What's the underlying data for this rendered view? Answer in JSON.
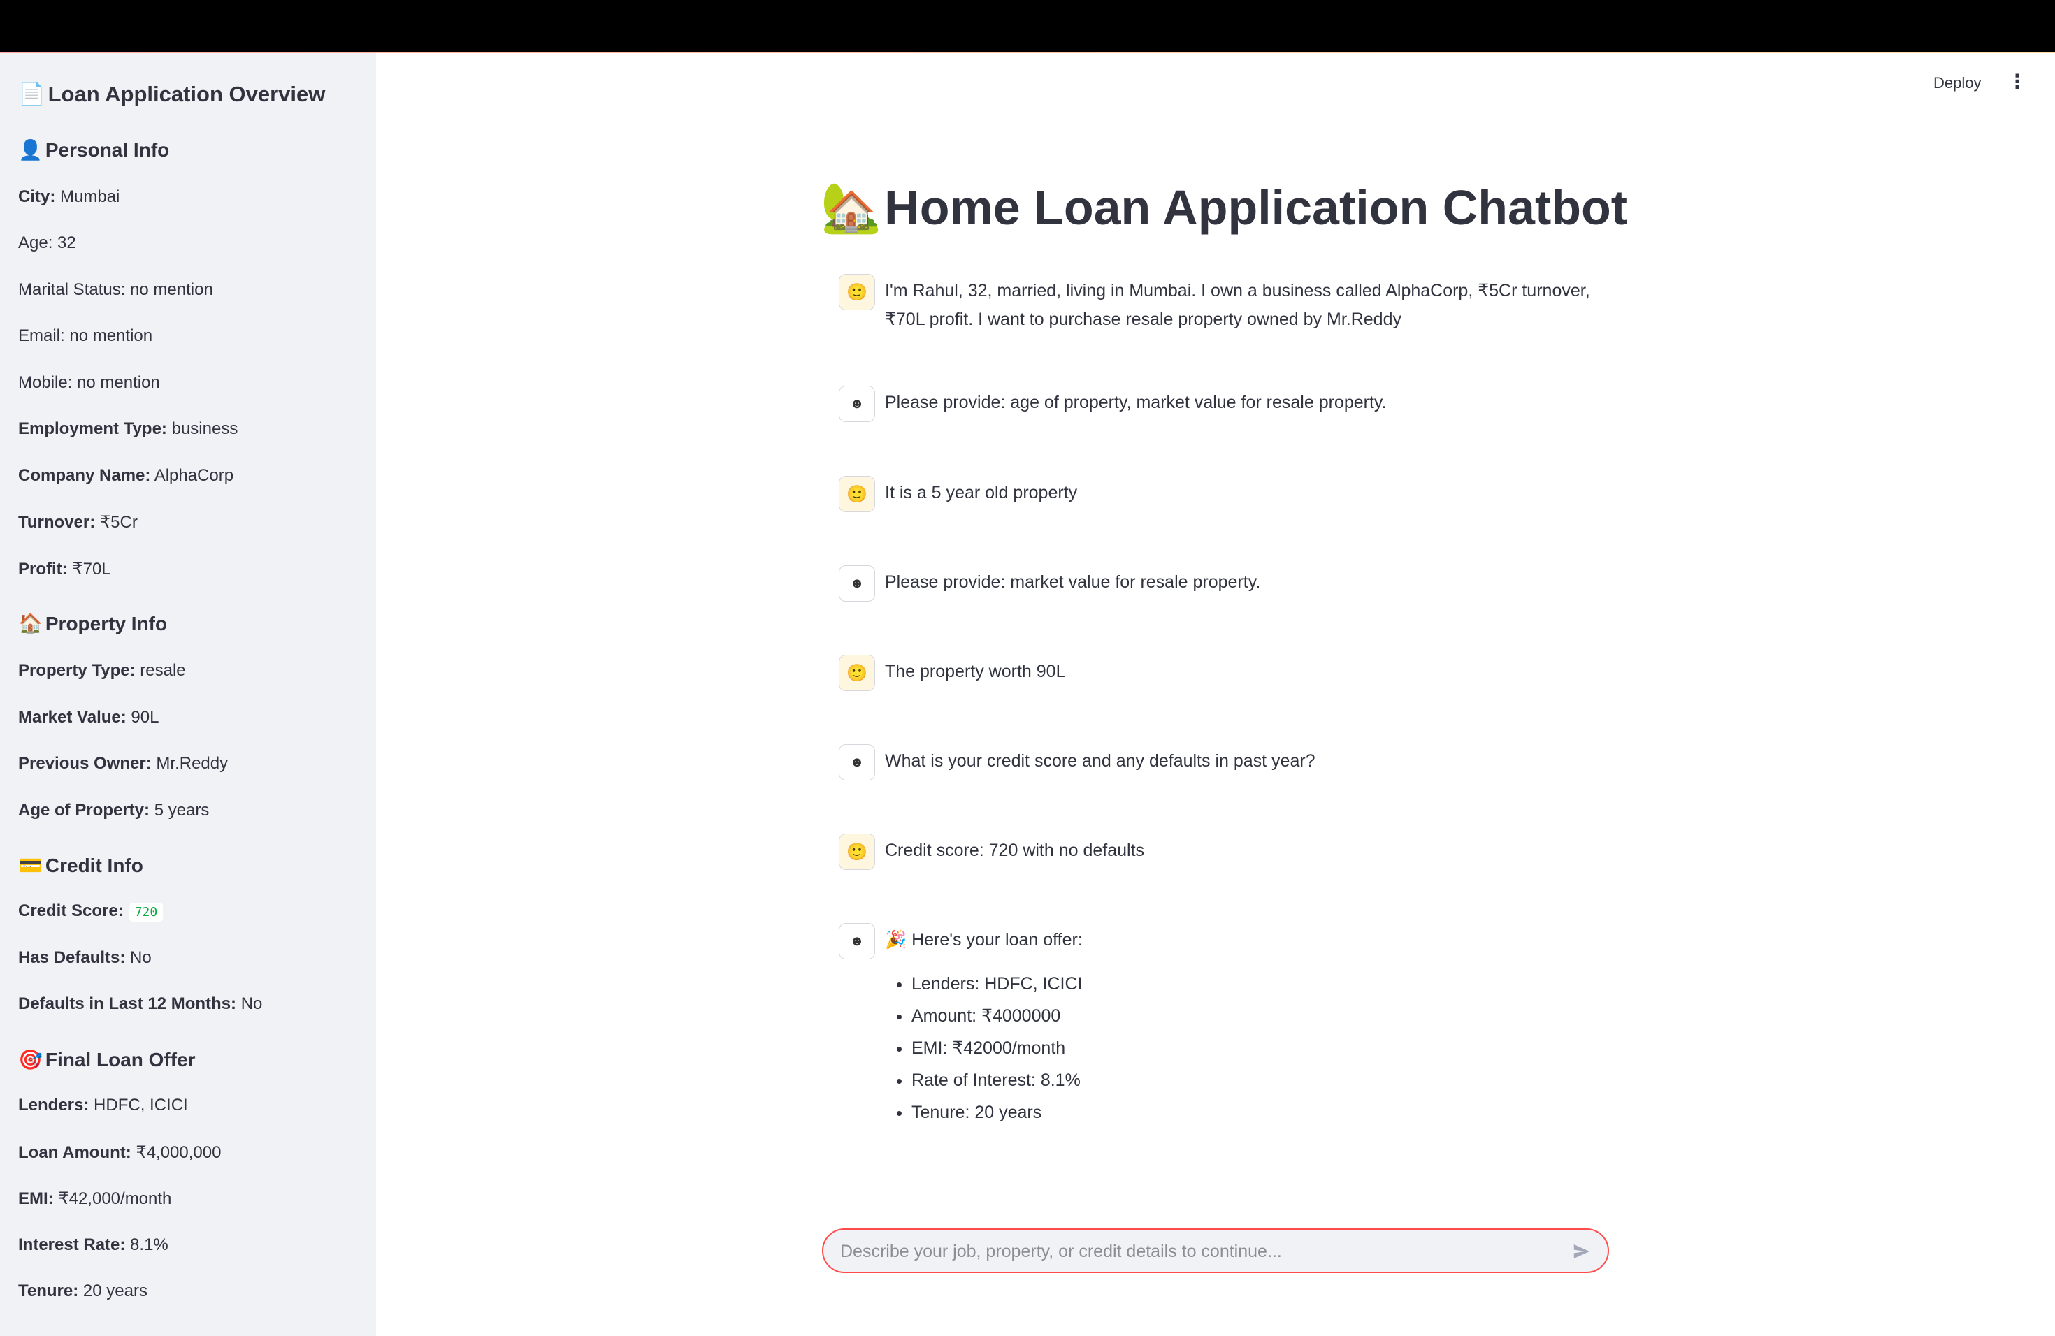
{
  "sidebar": {
    "title": "Loan Application Overview",
    "title_icon": "📄",
    "personal": {
      "icon": "👤",
      "heading": "Personal Info",
      "city_label": "City:",
      "city": "Mumbai",
      "age": "Age: 32",
      "marital": "Marital Status: no mention",
      "email": "Email: no mention",
      "mobile": "Mobile: no mention",
      "employment_label": "Employment Type:",
      "employment": "business",
      "company_label": "Company Name:",
      "company": "AlphaCorp",
      "turnover_label": "Turnover:",
      "turnover": "₹5Cr",
      "profit_label": "Profit:",
      "profit": "₹70L"
    },
    "property": {
      "icon": "🏠",
      "heading": "Property Info",
      "type_label": "Property Type:",
      "type": "resale",
      "market_label": "Market Value:",
      "market": "90L",
      "owner_label": "Previous Owner:",
      "owner": "Mr.Reddy",
      "age_label": "Age of Property:",
      "age": "5 years"
    },
    "credit": {
      "icon": "💳",
      "heading": "Credit Info",
      "score_label": "Credit Score:",
      "score": "720",
      "defaults_label": "Has Defaults:",
      "defaults": "No",
      "defaults12_label": "Defaults in Last 12 Months:",
      "defaults12": "No"
    },
    "offer": {
      "icon": "🎯",
      "heading": "Final Loan Offer",
      "lenders_label": "Lenders:",
      "lenders": "HDFC, ICICI",
      "amount_label": "Loan Amount:",
      "amount": "₹4,000,000",
      "emi_label": "EMI:",
      "emi": "₹42,000/month",
      "rate_label": "Interest Rate:",
      "rate": "8.1%",
      "tenure_label": "Tenure:",
      "tenure": "20 years"
    }
  },
  "header": {
    "deploy_label": "Deploy",
    "menu_icon": "⋮"
  },
  "main": {
    "title_icon": "🏡",
    "title": "Home Loan Application Chatbot",
    "messages": [
      {
        "role": "user",
        "text": "I'm Rahul, 32, married, living in Mumbai. I own a business called AlphaCorp, ₹5Cr turnover, ₹70L profit. I want to purchase resale property owned by Mr.Reddy"
      },
      {
        "role": "assistant",
        "text": "Please provide: age of property, market value for resale property."
      },
      {
        "role": "user",
        "text": "It is a 5 year old property"
      },
      {
        "role": "assistant",
        "text": "Please provide: market value for resale property."
      },
      {
        "role": "user",
        "text": "The property worth 90L"
      },
      {
        "role": "assistant",
        "text": "What is your credit score and any defaults in past year?"
      },
      {
        "role": "user",
        "text": "Credit score: 720 with no defaults"
      },
      {
        "role": "assistant",
        "text": "🎉 Here's your loan offer:",
        "items": [
          "Lenders: HDFC, ICICI",
          "Amount: ₹4000000",
          "EMI: ₹42000/month",
          "Rate of Interest: 8.1%",
          "Tenure: 20 years"
        ]
      }
    ],
    "user_avatar_icon": "🙂",
    "bot_avatar_icon": "☻"
  },
  "chat_input": {
    "placeholder": "Describe your job, property, or credit details to continue..."
  },
  "colors": {
    "accent": "#ff4b4b",
    "sidebar_bg": "#f0f2f6",
    "text": "#31333f"
  }
}
